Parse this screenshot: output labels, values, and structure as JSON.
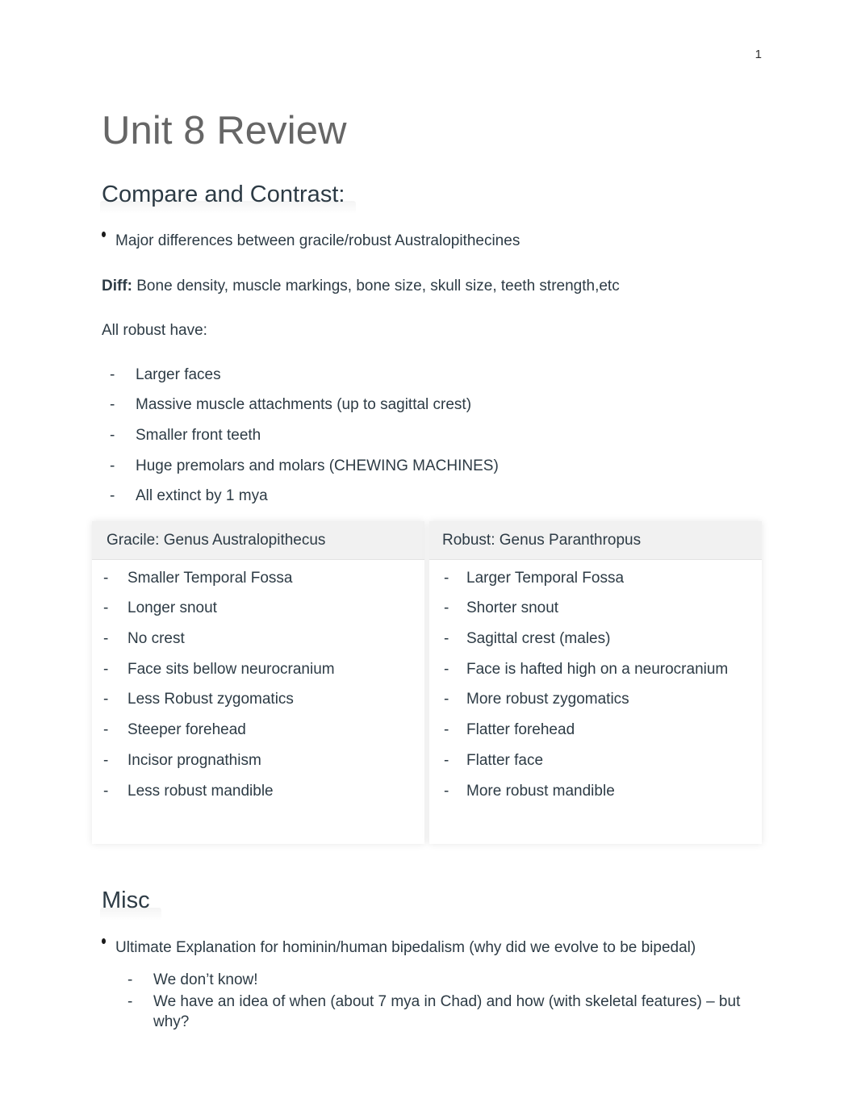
{
  "page": {
    "number": "1"
  },
  "document": {
    "title": "Unit 8 Review"
  },
  "sections": {
    "compare": {
      "heading": "Compare and Contrast:",
      "bullet": "Major differences between gracile/robust Australopithecines",
      "diff_label": "Diff:",
      "diff_text": " Bone density, muscle markings, bone size, skull size, teeth strength,etc",
      "all_robust_intro": "All robust have:",
      "all_robust_items": [
        "Larger faces",
        "Massive muscle attachments (up to sagittal crest)",
        "Smaller front teeth",
        "Huge premolars and molars (CHEWING MACHINES)",
        "All extinct by 1 mya"
      ]
    },
    "comparison_table": {
      "columns": [
        {
          "header": "Gracile: Genus Australopithecus",
          "items": [
            "Smaller Temporal Fossa",
            "Longer snout",
            "No crest",
            "Face sits bellow neurocranium",
            "Less Robust zygomatics",
            "Steeper forehead",
            "Incisor prognathism",
            "Less robust mandible"
          ]
        },
        {
          "header": "Robust: Genus Paranthropus",
          "items": [
            "Larger Temporal Fossa",
            "Shorter snout",
            "Sagittal crest (males)",
            "Face is hafted high on a neurocranium",
            "More robust zygomatics",
            "Flatter forehead",
            "Flatter face",
            "More robust mandible"
          ]
        }
      ]
    },
    "misc": {
      "heading": "Misc",
      "bullet": "Ultimate Explanation for hominin/human bipedalism (why did we evolve to be bipedal)",
      "items": [
        "We don’t know!",
        "We have an idea of when (about 7 mya in Chad) and how (with skeletal features) – but why?"
      ]
    }
  },
  "markers": {
    "dash": "-"
  },
  "colors": {
    "title": "#666666",
    "body_text": "#2d3b45",
    "page_background": "#ffffff",
    "table_header_background": "#f1f1f1"
  }
}
